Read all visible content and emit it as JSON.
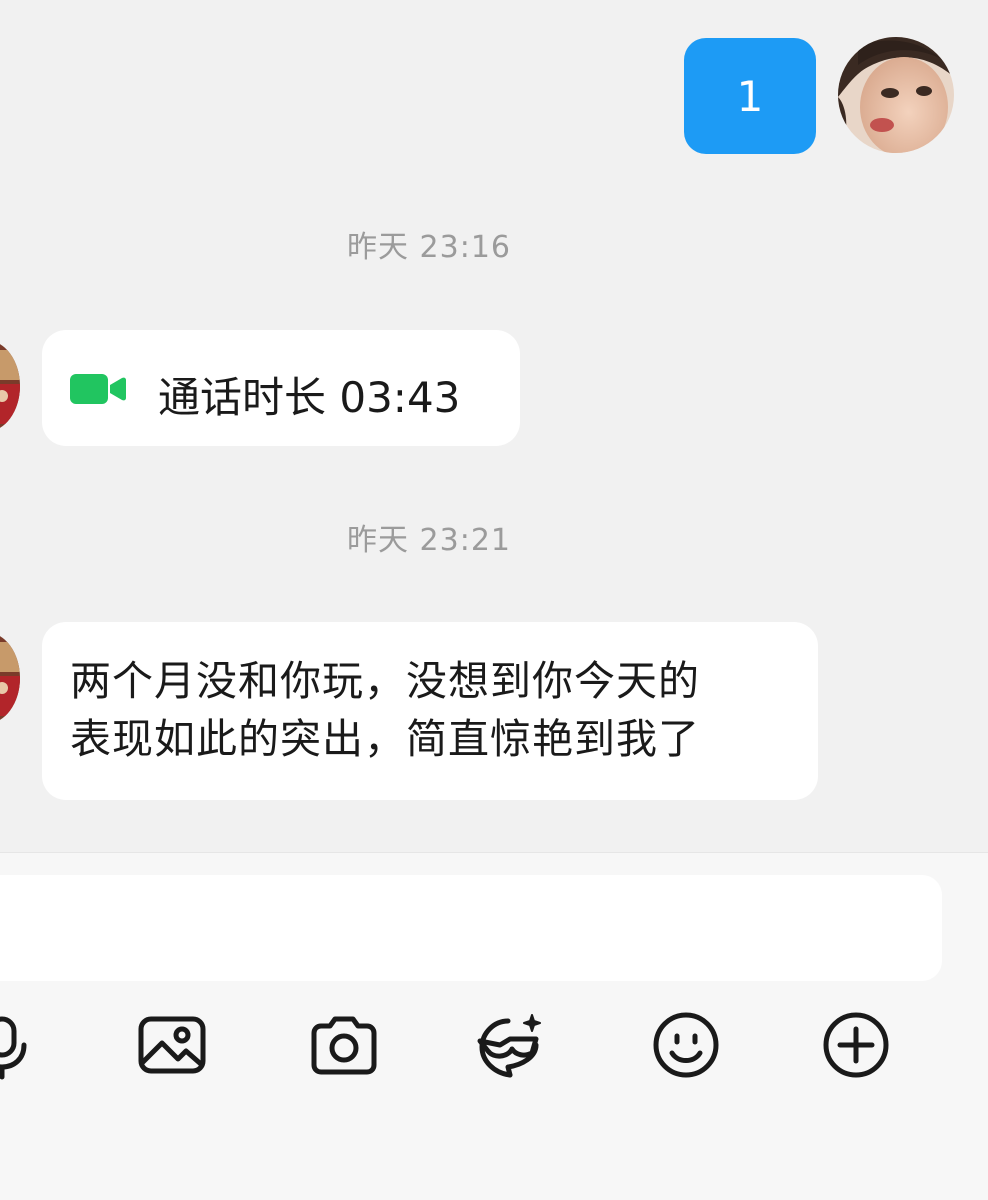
{
  "messages": {
    "outgoing": {
      "text": "1"
    },
    "timestamps": [
      "昨天 23:16",
      "昨天 23:21"
    ],
    "call": {
      "text": "通话时长 03:43",
      "icon": "video-call-icon"
    },
    "incoming_text": {
      "lines": [
        "两个月没和你玩，没想到你今天的",
        "表现如此的突出，简直惊艳到我了"
      ]
    }
  },
  "input": {
    "value": ""
  },
  "toolbar": {
    "icons": [
      "microphone-icon",
      "image-icon",
      "camera-icon",
      "sticker-icon",
      "emoji-icon",
      "plus-icon"
    ]
  },
  "colors": {
    "outgoing_bubble": "#1d9bf5",
    "call_icon": "#21c560",
    "background": "#f1f1f1"
  }
}
